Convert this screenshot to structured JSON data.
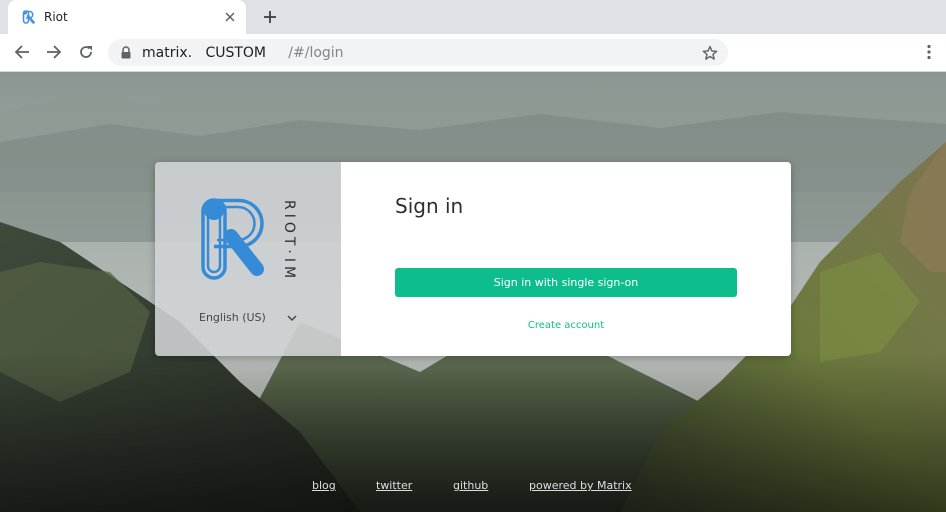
{
  "browser": {
    "tab": {
      "title": "Riot"
    },
    "address_bar": {
      "host": "matrix.",
      "redacted": "CUSTOM",
      "path": "/#/login"
    }
  },
  "login": {
    "brand_vertical_text": "RIOT·IM",
    "language": "English (US)",
    "title": "Sign in",
    "sso_button_label": "Sign in with single sign-on",
    "create_account_label": "Create account"
  },
  "footer": {
    "links": [
      "blog",
      "twitter",
      "github",
      "powered by Matrix"
    ]
  },
  "colors": {
    "accent": "#0dbd8b",
    "tab_strip": "#dee1e6",
    "omnibox": "#f1f3f4"
  },
  "icons": {
    "tab_favicon": "riot-favicon-icon",
    "tab_close": "close-icon",
    "new_tab": "plus-icon",
    "back": "back-arrow-icon",
    "forward": "forward-arrow-icon",
    "reload": "reload-icon",
    "lock": "lock-icon",
    "bookmark": "star-icon",
    "menu": "kebab-menu-icon",
    "language": "chevron-down-icon"
  }
}
